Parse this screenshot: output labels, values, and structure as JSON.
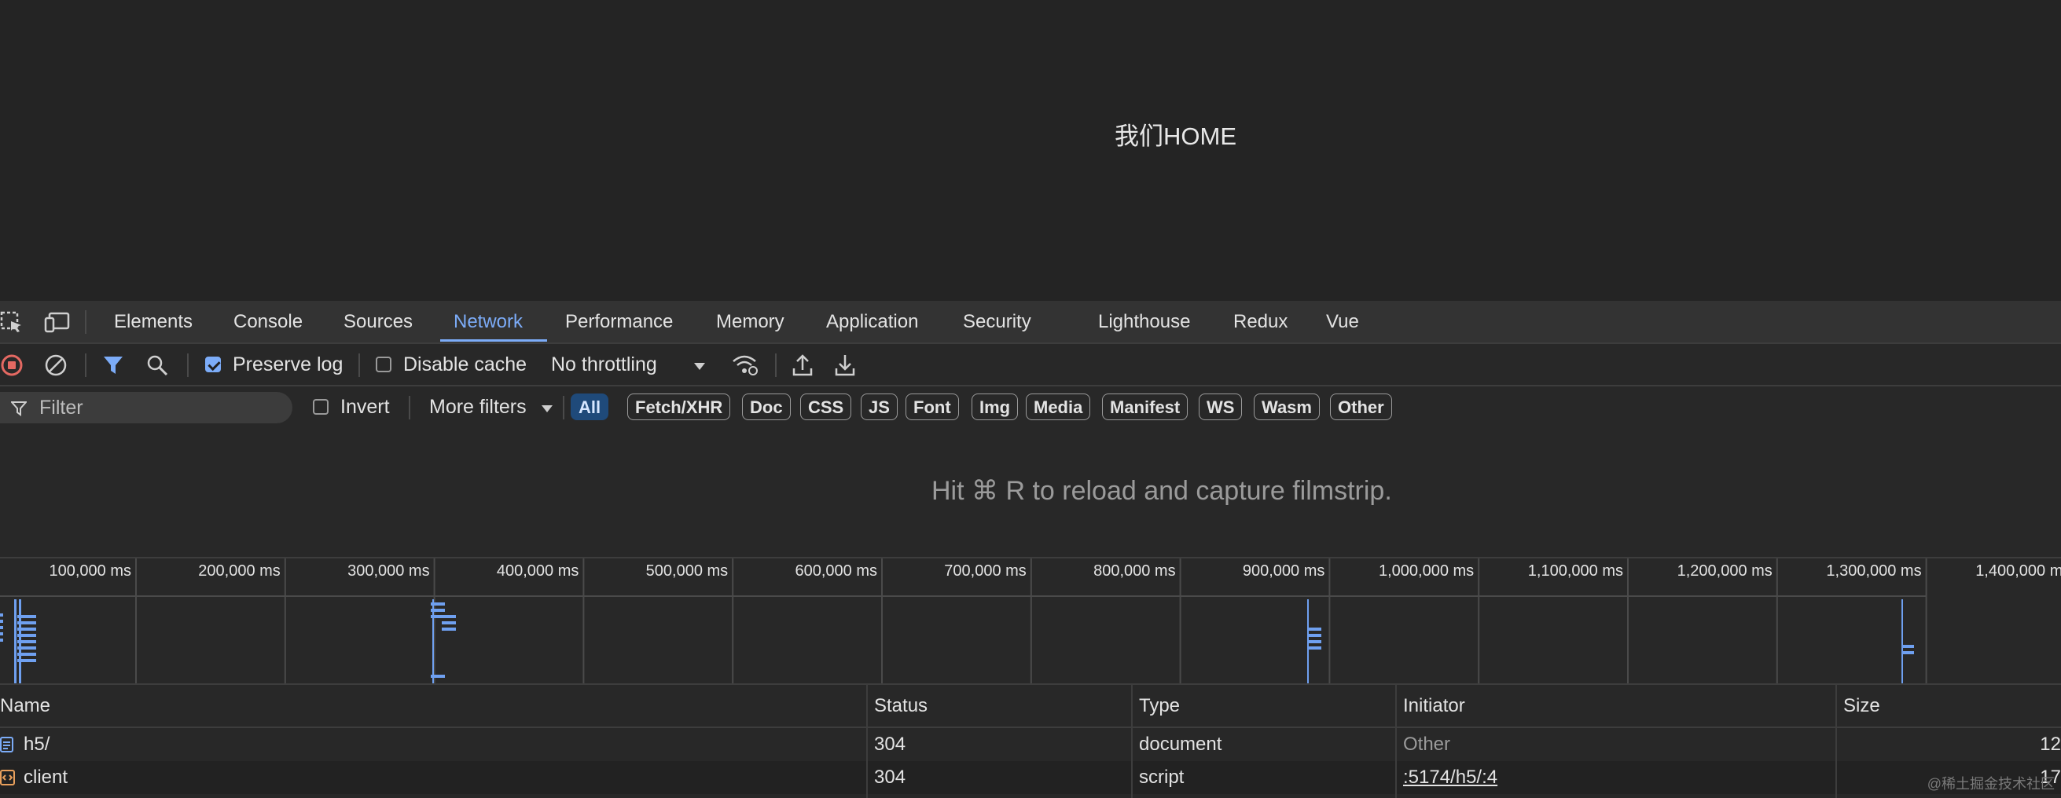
{
  "page": {
    "heading": "我们HOME"
  },
  "devtools": {
    "tabs": [
      {
        "label": "Elements"
      },
      {
        "label": "Console"
      },
      {
        "label": "Sources"
      },
      {
        "label": "Network",
        "active": true
      },
      {
        "label": "Performance"
      },
      {
        "label": "Memory"
      },
      {
        "label": "Application"
      },
      {
        "label": "Security"
      },
      {
        "label": "Lighthouse"
      },
      {
        "label": "Redux"
      },
      {
        "label": "Vue"
      }
    ],
    "toolbar": {
      "preserve_log_label": "Preserve log",
      "preserve_log_checked": true,
      "disable_cache_label": "Disable cache",
      "disable_cache_checked": false,
      "throttling_value": "No throttling"
    },
    "filterbar": {
      "filter_placeholder": "Filter",
      "invert_label": "Invert",
      "more_filters_label": "More filters",
      "chips": [
        {
          "label": "All",
          "active": true
        },
        {
          "label": "Fetch/XHR"
        },
        {
          "label": "Doc"
        },
        {
          "label": "CSS"
        },
        {
          "label": "JS"
        },
        {
          "label": "Font"
        },
        {
          "label": "Img"
        },
        {
          "label": "Media"
        },
        {
          "label": "Manifest"
        },
        {
          "label": "WS"
        },
        {
          "label": "Wasm"
        },
        {
          "label": "Other"
        }
      ]
    },
    "filmstrip_message": "Hit ⌘ R to reload and capture filmstrip.",
    "timeline_ticks": [
      "100,000 ms",
      "200,000 ms",
      "300,000 ms",
      "400,000 ms",
      "500,000 ms",
      "600,000 ms",
      "700,000 ms",
      "800,000 ms",
      "900,000 ms",
      "1,000,000 ms",
      "1,100,000 ms",
      "1,200,000 ms",
      "1,300,000 ms",
      "1,400,000 ms"
    ],
    "table": {
      "columns": {
        "name": "Name",
        "status": "Status",
        "type": "Type",
        "initiator": "Initiator",
        "size": "Size"
      },
      "rows": [
        {
          "name": "h5/",
          "status": "304",
          "type": "document",
          "initiator": "Other",
          "size": "12",
          "icon": "document-icon"
        },
        {
          "name": "client",
          "status": "304",
          "type": "script",
          "initiator": ":5174/h5/:4",
          "size": "17",
          "icon": "script-icon"
        }
      ]
    },
    "watermark": "@稀土掘金技术社区"
  },
  "colors": {
    "accent": "#7cacf8",
    "background": "#282828",
    "record_red": "#e46962",
    "timeline_bar": "#6fa0f0"
  }
}
